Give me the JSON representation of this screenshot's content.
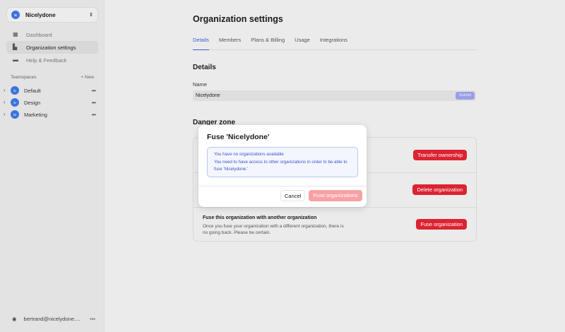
{
  "sidebar": {
    "org": {
      "initial": "N",
      "name": "Nicelydone"
    },
    "nav": [
      {
        "label": "Dashboard"
      },
      {
        "label": "Organization settings"
      },
      {
        "label": "Help & Feedback"
      }
    ],
    "teamspaces_label": "Teamspaces",
    "new_label": "New",
    "teams": [
      {
        "initial": "D",
        "name": "Default"
      },
      {
        "initial": "D",
        "name": "Design"
      },
      {
        "initial": "M",
        "name": "Marketing"
      }
    ],
    "user": "bertrand@nicelydone...."
  },
  "main": {
    "title": "Organization settings",
    "tabs": [
      "Details",
      "Members",
      "Plans & Billing",
      "Usage",
      "Integrations"
    ],
    "details_heading": "Details",
    "name_label": "Name",
    "name_value": "Nicelydone",
    "submit_label": "Submit",
    "danger_heading": "Danger zone",
    "transfer_label": "Transfer ownership",
    "delete_label": "Delete organization",
    "fuse_title": "Fuse this organization with another organization",
    "fuse_desc": "Once you fuse your organization with a different organization, there is no going back. Please be certain.",
    "fuse_label": "Fuse organization"
  },
  "modal": {
    "title": "Fuse 'Nicelydone'",
    "alert_title": "You have no organizations available",
    "alert_body": "You need to have access to other organizations in order to be able to fuse 'Nicelydone.'",
    "cancel": "Cancel",
    "confirm": "Fuse organizations"
  }
}
